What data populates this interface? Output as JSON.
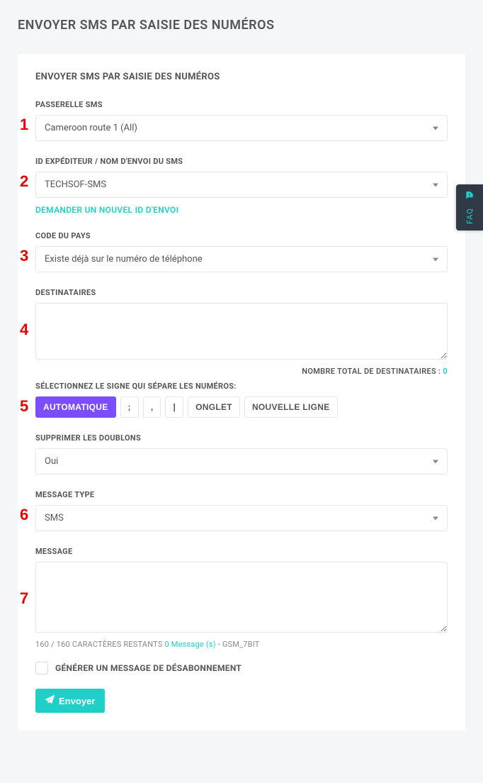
{
  "page": {
    "title": "ENVOYER SMS PAR SAISIE DES NUMÉROS"
  },
  "card": {
    "title": "ENVOYER SMS PAR SAISIE DES NUMÉROS"
  },
  "steps": {
    "s1": "1",
    "s2": "2",
    "s3": "3",
    "s4": "4",
    "s5": "5",
    "s6": "6",
    "s7": "7"
  },
  "gateway": {
    "label": "PASSERELLE SMS",
    "value": "Cameroon route 1 (All)"
  },
  "sender": {
    "label": "ID EXPÉDITEUR / NOM D'ENVOI DU SMS",
    "value": "TECHSOF-SMS",
    "request_link": "DEMANDER UN NOUVEL ID D'ENVOI"
  },
  "country": {
    "label": "CODE DU PAYS",
    "value": "Existe déjà sur le numéro de téléphone"
  },
  "recipients": {
    "label": "DESTINATAIRES",
    "value": "",
    "count_label": "NOMBRE TOTAL DE DESTINATAIRES : ",
    "count_value": "0"
  },
  "delimiter": {
    "label": "SÉLECTIONNEZ LE SIGNE QUI SÉPARE LES NUMÉROS:",
    "options": {
      "auto": "AUTOMATIQUE",
      "semicolon": ";",
      "comma": ",",
      "pipe": "|",
      "tab": "ONGLET",
      "newline": "NOUVELLE LIGNE"
    }
  },
  "dedup": {
    "label": "SUPPRIMER LES DOUBLONS",
    "value": "Oui"
  },
  "msgtype": {
    "label": "MESSAGE TYPE",
    "value": "SMS"
  },
  "message": {
    "label": "MESSAGE",
    "value": "",
    "counter_prefix": "160",
    "counter_sep": " / ",
    "counter_remaining": "160 CARACTÈRES RESTANTS ",
    "counter_msgs": "0 Message (s)",
    "counter_enc_sep": " - ",
    "counter_enc": "GSM_7BIT"
  },
  "unsub": {
    "label": "GÉNÉRER UN MESSAGE DE DÉSABONNEMENT"
  },
  "send": {
    "label": "Envoyer"
  },
  "faq": {
    "label": "FAQ"
  }
}
